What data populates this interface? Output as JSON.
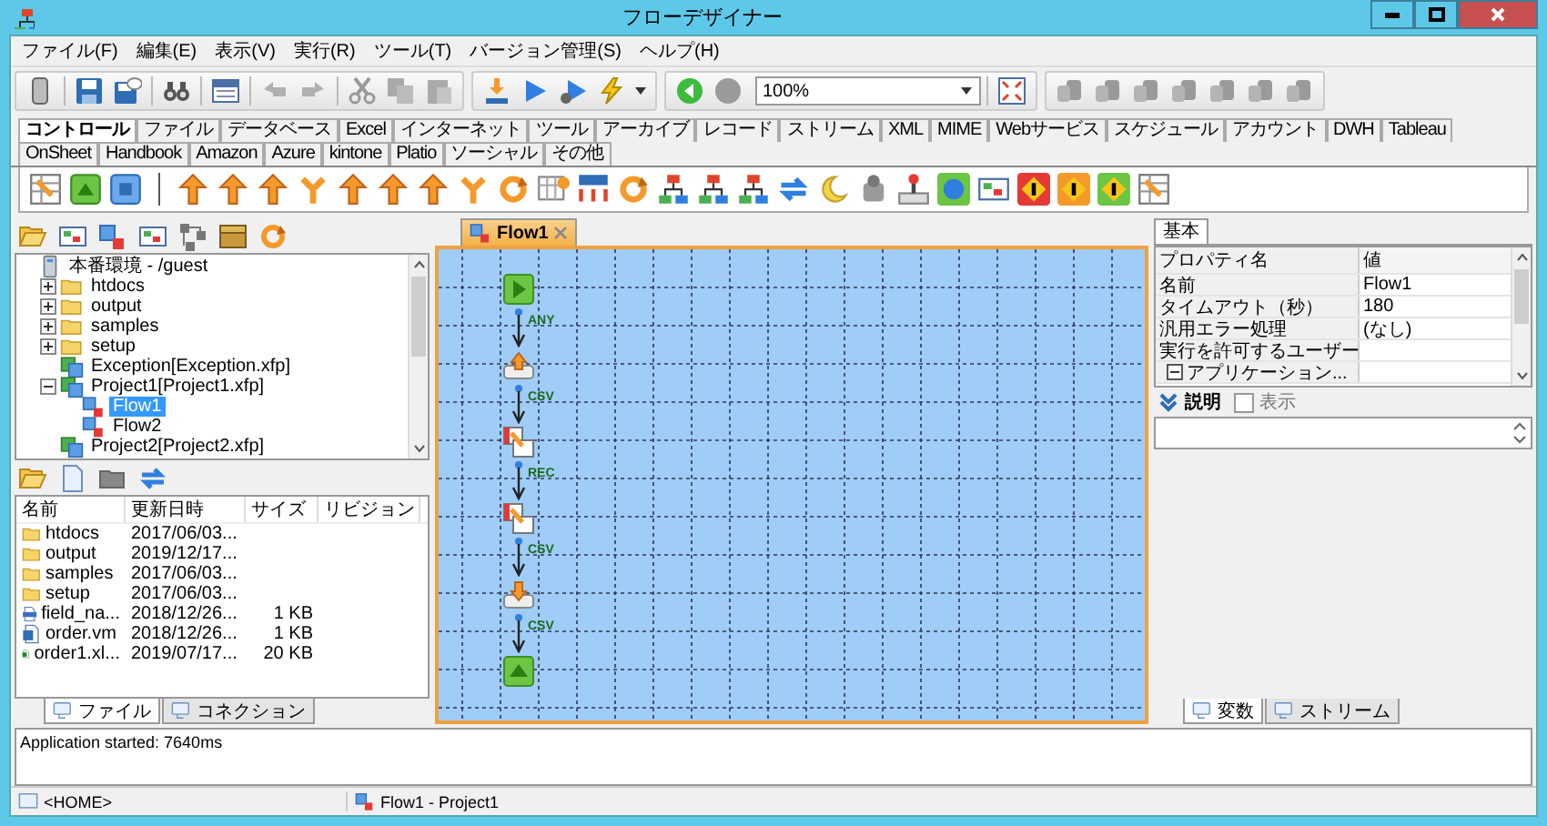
{
  "window": {
    "title": "フローデザイナー"
  },
  "menu": [
    "ファイル(F)",
    "編集(E)",
    "表示(V)",
    "実行(R)",
    "ツール(T)",
    "バージョン管理(S)",
    "ヘルプ(H)"
  ],
  "toolbar": {
    "zoom": "100%"
  },
  "palette": {
    "tabs": [
      {
        "label": "コントロール",
        "selected": true
      },
      {
        "label": "ファイル",
        "selected": false
      },
      {
        "label": "データベース",
        "selected": false
      },
      {
        "label": "Excel",
        "selected": false
      },
      {
        "label": "インターネット",
        "selected": false
      },
      {
        "label": "ツール",
        "selected": false
      },
      {
        "label": "アーカイブ",
        "selected": false
      },
      {
        "label": "レコード",
        "selected": false
      },
      {
        "label": "ストリーム",
        "selected": false
      },
      {
        "label": "XML",
        "selected": false
      },
      {
        "label": "MIME",
        "selected": false
      },
      {
        "label": "Webサービス",
        "selected": false
      },
      {
        "label": "スケジュール",
        "selected": false
      },
      {
        "label": "アカウント",
        "selected": false
      },
      {
        "label": "DWH",
        "selected": false
      },
      {
        "label": "Tableau",
        "selected": false
      },
      {
        "label": "OnSheet",
        "selected": false
      },
      {
        "label": "Handbook",
        "selected": false
      },
      {
        "label": "Amazon",
        "selected": false
      },
      {
        "label": "Azure",
        "selected": false
      },
      {
        "label": "kintone",
        "selected": false
      },
      {
        "label": "Platio",
        "selected": false
      },
      {
        "label": "ソーシャル",
        "selected": false
      },
      {
        "label": "その他",
        "selected": false
      }
    ]
  },
  "explorer": {
    "tree": [
      {
        "label": "本番環境 - /guest",
        "kind": "server",
        "selected": false,
        "children": [
          {
            "label": "htdocs",
            "kind": "folder",
            "expanded": false,
            "selected": false
          },
          {
            "label": "output",
            "kind": "folder",
            "expanded": false,
            "selected": false
          },
          {
            "label": "samples",
            "kind": "folder",
            "expanded": false,
            "selected": false
          },
          {
            "label": "setup",
            "kind": "folder",
            "expanded": false,
            "selected": false
          },
          {
            "label": "Exception[Exception.xfp]",
            "kind": "project",
            "selected": false
          },
          {
            "label": "Project1[Project1.xfp]",
            "kind": "project",
            "expanded": true,
            "selected": false,
            "children": [
              {
                "label": "Flow1",
                "kind": "flow",
                "selected": true
              },
              {
                "label": "Flow2",
                "kind": "flow",
                "selected": false
              }
            ]
          },
          {
            "label": "Project2[Project2.xfp]",
            "kind": "project",
            "selected": false
          }
        ]
      }
    ]
  },
  "files": {
    "columns": [
      "名前",
      "更新日時",
      "サイズ",
      "リビジョン"
    ],
    "rows": [
      {
        "kind": "folder",
        "name": "htdocs",
        "modified": "2017/06/03..."
      },
      {
        "kind": "folder",
        "name": "output",
        "modified": "2019/12/17..."
      },
      {
        "kind": "folder",
        "name": "samples",
        "modified": "2017/06/03..."
      },
      {
        "kind": "folder",
        "name": "setup",
        "modified": "2017/06/03..."
      },
      {
        "kind": "csv",
        "name": "field_na...",
        "modified": "2018/12/26...",
        "size": "1 KB"
      },
      {
        "kind": "text",
        "name": "order.vm",
        "modified": "2018/12/26...",
        "size": "1 KB"
      },
      {
        "kind": "sheet",
        "name": "order1.xl...",
        "modified": "2019/07/17...",
        "size": "20 KB"
      }
    ]
  },
  "left_tabs": [
    {
      "label": "ファイル",
      "selected": true
    },
    {
      "label": "コネクション",
      "selected": false
    }
  ],
  "editor": {
    "tab": {
      "label": "Flow1",
      "selected": true
    },
    "nodes": [
      {
        "kind": "start"
      },
      {
        "kind": "upload"
      },
      {
        "kind": "mapper"
      },
      {
        "kind": "mapper"
      },
      {
        "kind": "download"
      },
      {
        "kind": "end"
      }
    ],
    "connectors": [
      {
        "label": "ANY"
      },
      {
        "label": "CSV"
      },
      {
        "label": "REC"
      },
      {
        "label": "CSV"
      },
      {
        "label": "CSV"
      }
    ]
  },
  "properties": {
    "tab": "基本",
    "columns": [
      "プロパティ名",
      "値"
    ],
    "rows": [
      {
        "kind": "field",
        "name": "名前",
        "value": "Flow1"
      },
      {
        "kind": "field",
        "name": "タイムアウト（秒）",
        "value": "180"
      },
      {
        "kind": "field",
        "name": "汎用エラー処理",
        "value": "(なし)"
      },
      {
        "kind": "field",
        "name": "実行を許可するユーザー"
      },
      {
        "kind": "group",
        "name": "アプリケーション...",
        "expanded": true
      }
    ],
    "description": {
      "label": "説明",
      "checkbox": {
        "label": "表示",
        "checked": false
      }
    }
  },
  "right_tabs": [
    {
      "label": "変数",
      "selected": true
    },
    {
      "label": "ストリーム",
      "selected": false
    }
  ],
  "log": "Application started: 7640ms",
  "status_bar": {
    "home": "<HOME>",
    "flow": "Flow1 - Project1"
  }
}
